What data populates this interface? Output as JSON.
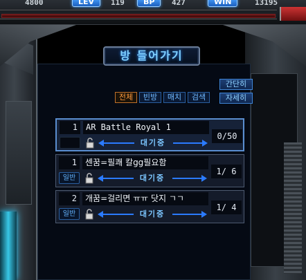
{
  "hud": {
    "gold": "4800",
    "level_label": "LEV",
    "level": "119",
    "bp_label": "BP",
    "bp": "427",
    "win_label": "WIN",
    "wins": "13195"
  },
  "window": {
    "title": "방 들어가기",
    "filters": [
      "전체",
      "빈방",
      "매치",
      "검색"
    ],
    "active_filter": "전체",
    "view_simple": "간단히",
    "view_detail": "자세히"
  },
  "rooms": [
    {
      "number": "1",
      "name": "AR Battle Royal 1",
      "mode": "",
      "status": "대기중",
      "players": "0/50",
      "selected": true
    },
    {
      "number": "1",
      "name": "센꿈=필쾌 칼gg필요함",
      "mode": "일반",
      "status": "대기중",
      "players": "1/ 6",
      "selected": false
    },
    {
      "number": "2",
      "name": "개꿈=걸리면 ㅠㅠ 닷지 ㄱㄱ",
      "mode": "일반",
      "status": "대기중",
      "players": "1/ 4",
      "selected": false
    }
  ],
  "colors": {
    "accent_blue": "#4aa3ff",
    "active_filter": "#ff9a3c",
    "status_text": "#7cc6ff"
  }
}
